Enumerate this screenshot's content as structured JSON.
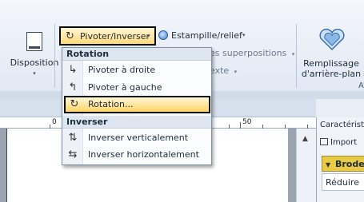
{
  "ribbon": {
    "disposition_label": "Disposition",
    "pivot_label": "Pivoter/Inverser",
    "stamp_label": "Estampille/relief",
    "superpositions_label": "es superpositions",
    "texte_label": "exte",
    "background_fill_line1": "Remplissage",
    "background_fill_line2": "d'arrière-plan",
    "group_letter": "A",
    "caret": "▾"
  },
  "ruler": {
    "labels": [
      "0",
      "50"
    ]
  },
  "right_panel": {
    "title": "Caractérist",
    "import_label": "Import",
    "embroidery_label": "Brode",
    "reduce_label": "Réduire"
  },
  "menu": {
    "section_rotation": "Rotation",
    "rotate_right": "Pivoter à droite",
    "rotate_left": "Pivoter à gauche",
    "rotation_dialog": "Rotation...",
    "section_flip": "Inverser",
    "flip_vertical": "Inverser verticalement",
    "flip_horizontal": "Inverser horizontalement"
  },
  "icons": {
    "rotate": "↻",
    "rotate_right": "↳",
    "rotate_left": "↰",
    "flip_vertical": "⇅",
    "flip_horizontal": "⇆",
    "scroll_up": "▲",
    "collapse": "▼"
  },
  "colors": {
    "highlight": "#ffd467",
    "embroidery_header": "#e8ca45",
    "highlight_border": "#0a0a0a"
  }
}
